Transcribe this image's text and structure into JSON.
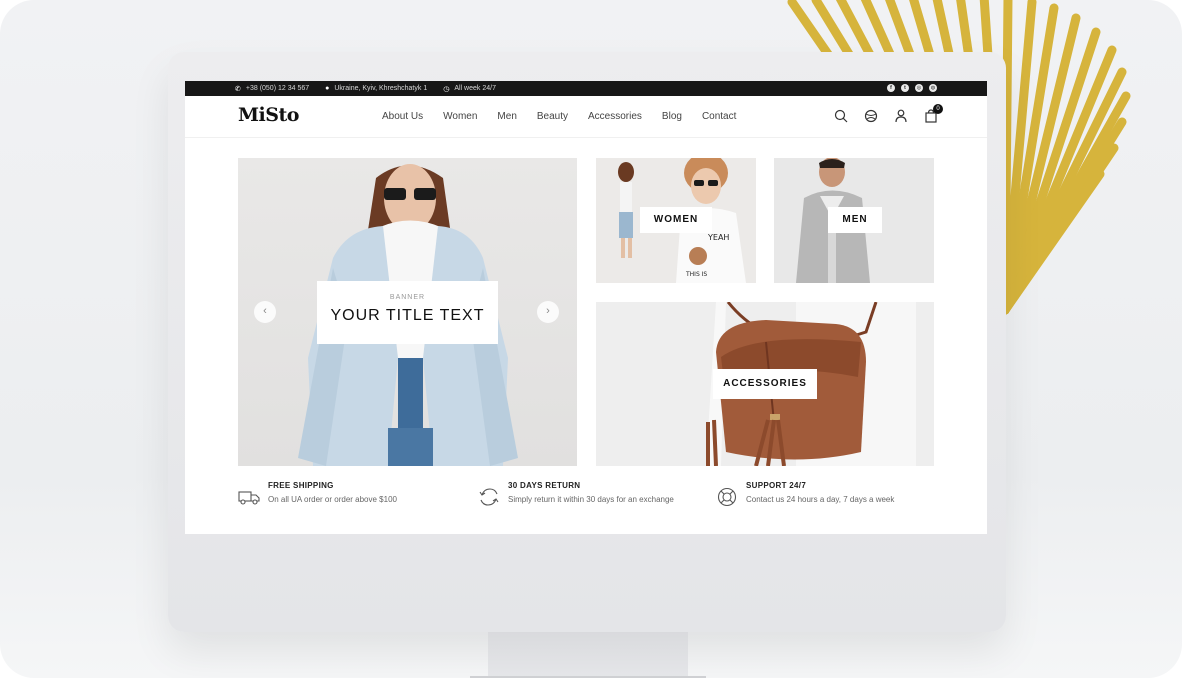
{
  "topbar": {
    "phone": "+38 (050) 12 34 567",
    "address": "Ukraine, Kyiv, Khreshchatyk 1",
    "hours": "All week 24/7",
    "social": [
      "facebook-icon",
      "twitter-icon",
      "instagram-icon",
      "dribbble-icon"
    ]
  },
  "header": {
    "logo": "MiSto",
    "nav": [
      "About Us",
      "Women",
      "Men",
      "Beauty",
      "Accessories",
      "Blog",
      "Contact"
    ],
    "cart_count": "0"
  },
  "banner": {
    "small": "BANNER",
    "title": "YOUR TITLE TEXT",
    "prev_icon": "‹",
    "next_icon": "›"
  },
  "tiles": {
    "women": "WOMEN",
    "men": "MEN",
    "accessories": "ACCESSORIES"
  },
  "features": [
    {
      "title": "FREE SHIPPING",
      "desc": "On all UA order or order above $100"
    },
    {
      "title": "30 DAYS RETURN",
      "desc": "Simply return it within 30 days for an exchange"
    },
    {
      "title": "SUPPORT 24/7",
      "desc": "Contact us 24 hours a day, 7 days a week"
    }
  ],
  "colors": {
    "topbar": "#171717",
    "accent_gold": "#d8b43a",
    "bag": "#a15b3a"
  }
}
